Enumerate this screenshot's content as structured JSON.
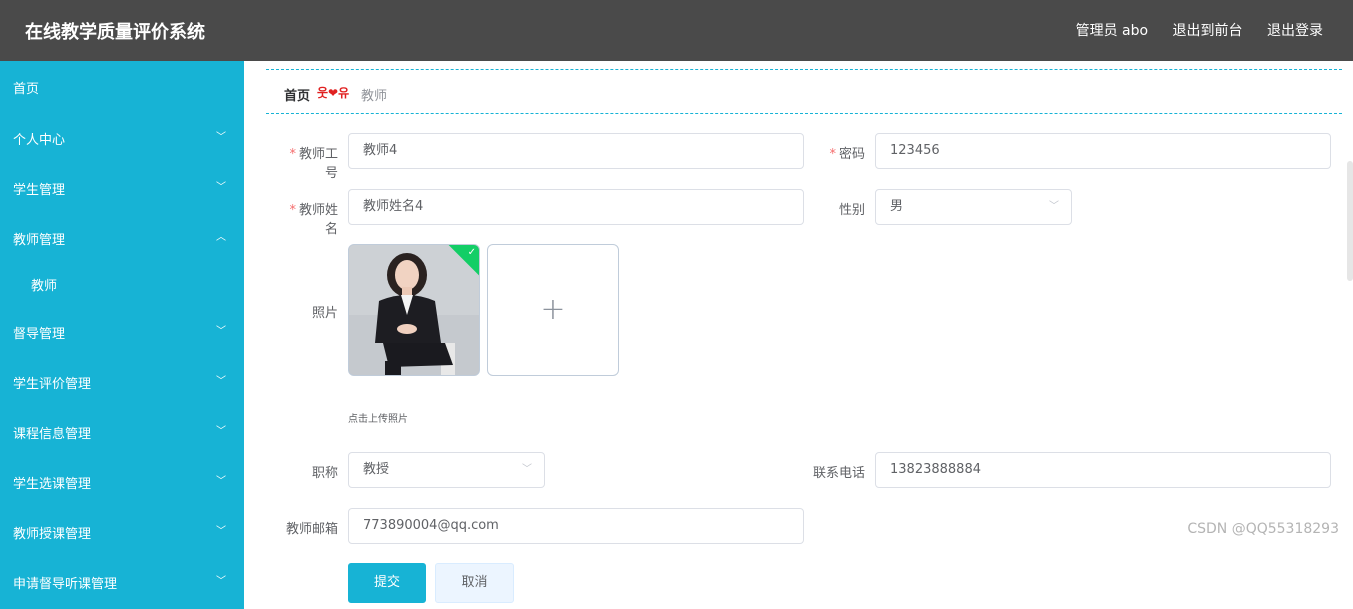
{
  "header": {
    "title": "在线教学质量评价系统",
    "user": "管理员 abo",
    "front_link": "退出到前台",
    "logout": "退出登录"
  },
  "sidebar": {
    "items": [
      {
        "label": "首页",
        "arrow": ""
      },
      {
        "label": "个人中心",
        "arrow": "﹀"
      },
      {
        "label": "学生管理",
        "arrow": "﹀"
      },
      {
        "label": "教师管理",
        "arrow": "︿"
      },
      {
        "label": "教师",
        "arrow": ""
      },
      {
        "label": "督导管理",
        "arrow": "﹀"
      },
      {
        "label": "学生评价管理",
        "arrow": "﹀"
      },
      {
        "label": "课程信息管理",
        "arrow": "﹀"
      },
      {
        "label": "学生选课管理",
        "arrow": "﹀"
      },
      {
        "label": "教师授课管理",
        "arrow": "﹀"
      },
      {
        "label": "申请督导听课管理",
        "arrow": "﹀"
      }
    ]
  },
  "breadcrumb": {
    "home": "首页",
    "separator": "웃❤유",
    "current": "教师"
  },
  "form": {
    "teacher_id_label": "教师工号",
    "teacher_id_value": "教师4",
    "password_label": "密码",
    "password_value": "123456",
    "teacher_name_label": "教师姓名",
    "teacher_name_value": "教师姓名4",
    "gender_label": "性别",
    "gender_value": "男",
    "photo_label": "照片",
    "photo_tip": "点击上传照片",
    "title_label": "职称",
    "title_value": "教授",
    "phone_label": "联系电话",
    "phone_value": "13823888884",
    "email_label": "教师邮箱",
    "email_value": "773890004@qq.com",
    "submit": "提交",
    "cancel": "取消"
  },
  "watermark": "CSDN @QQ55318293",
  "colors": {
    "header_bg": "#4a4a4a",
    "sidebar_bg": "#17b3d5",
    "primary": "#17b3d5",
    "required": "#f56c6c"
  }
}
